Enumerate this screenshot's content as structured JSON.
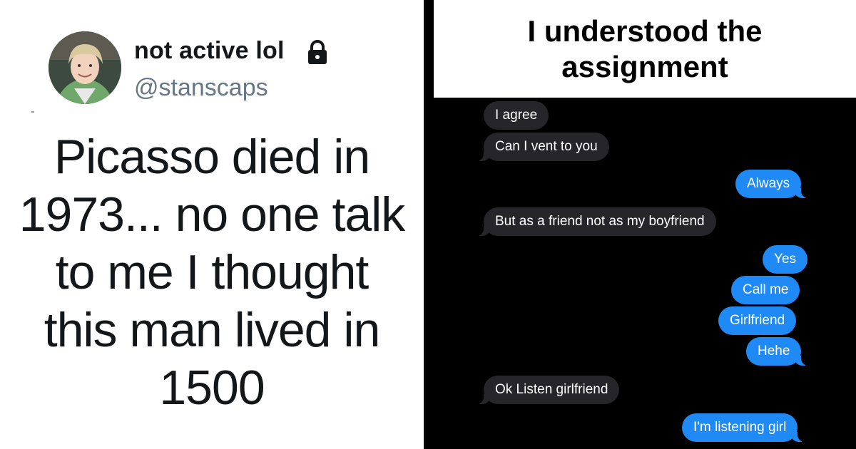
{
  "tweet": {
    "display_name": "not active lol",
    "handle": "@stanscaps",
    "text": "Picasso died in 1973... no one talk to me I thought this man lived in 1500",
    "lock_icon": "lock-icon",
    "colors": {
      "name": "#14171a",
      "handle": "#657786"
    }
  },
  "meme": {
    "caption": "I understood the assignment",
    "messages": [
      {
        "side": "received",
        "text": "I agree"
      },
      {
        "side": "received",
        "text": "Can I vent to you"
      },
      {
        "side": "sent",
        "text": "Always"
      },
      {
        "side": "received",
        "text": "But as a friend not as my boyfriend"
      },
      {
        "side": "sent",
        "text": "Yes"
      },
      {
        "side": "sent",
        "text": "Call me"
      },
      {
        "side": "sent",
        "text": "Girlfriend"
      },
      {
        "side": "sent",
        "text": "Hehe"
      },
      {
        "side": "received",
        "text": "Ok Listen girlfriend"
      },
      {
        "side": "sent",
        "text": "I'm listening girl"
      }
    ],
    "colors": {
      "sent": "#1f8af6",
      "received": "#26252a",
      "background": "#000000"
    }
  }
}
